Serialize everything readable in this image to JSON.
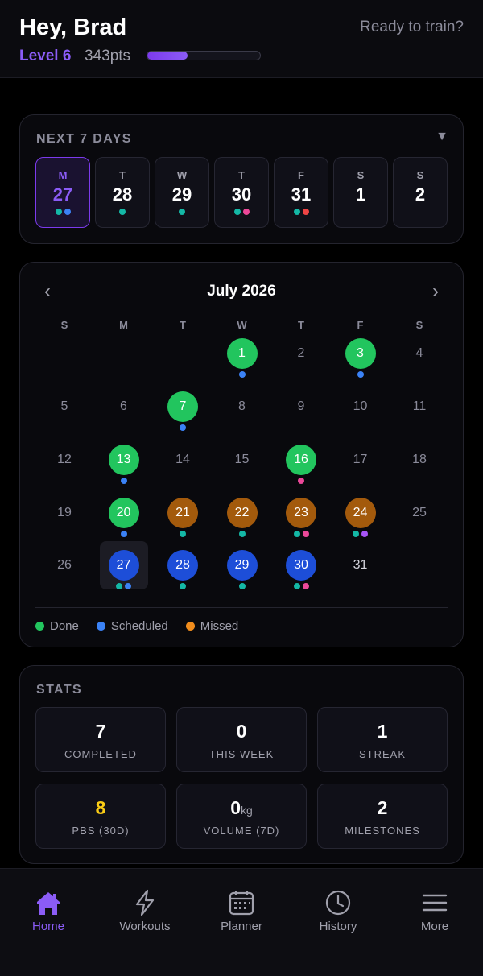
{
  "header": {
    "greeting": "Hey, Brad",
    "ready_text": "Ready to train?",
    "level": "Level 6",
    "points": "343pts",
    "progress_fraction": 0.36,
    "accent_color": "#8b5cf6"
  },
  "week": {
    "title": "NEXT 7 DAYS",
    "toggle_icon": "caret-down-icon",
    "toggle_glyph": "▼",
    "days": [
      {
        "letter": "M",
        "number": "27",
        "active": true,
        "dots": [
          "#14b8a6",
          "#3b82f6"
        ]
      },
      {
        "letter": "T",
        "number": "28",
        "active": false,
        "dots": [
          "#14b8a6"
        ]
      },
      {
        "letter": "W",
        "number": "29",
        "active": false,
        "dots": [
          "#14b8a6"
        ]
      },
      {
        "letter": "T",
        "number": "30",
        "active": false,
        "dots": [
          "#14b8a6",
          "#ec4899"
        ]
      },
      {
        "letter": "F",
        "number": "31",
        "active": false,
        "dots": [
          "#14b8a6",
          "#ef4444"
        ]
      },
      {
        "letter": "S",
        "number": "1",
        "active": false,
        "dots": []
      },
      {
        "letter": "S",
        "number": "2",
        "active": false,
        "dots": []
      }
    ]
  },
  "calendar": {
    "month": "July 2026",
    "prev_glyph": "‹",
    "next_glyph": "›",
    "weekdays": [
      "S",
      "M",
      "T",
      "W",
      "T",
      "F",
      "S"
    ],
    "days": [
      {
        "n": "1",
        "status": "done",
        "dots": [
          "#3b82f6"
        ]
      },
      {
        "n": "2",
        "status": "none",
        "dots": []
      },
      {
        "n": "3",
        "status": "done",
        "dots": [
          "#3b82f6"
        ]
      },
      {
        "n": "4",
        "status": "none",
        "dots": []
      },
      {
        "n": "5",
        "status": "none",
        "dots": []
      },
      {
        "n": "6",
        "status": "none",
        "dots": []
      },
      {
        "n": "7",
        "status": "done",
        "dots": [
          "#3b82f6"
        ]
      },
      {
        "n": "8",
        "status": "none",
        "dots": []
      },
      {
        "n": "9",
        "status": "none",
        "dots": []
      },
      {
        "n": "10",
        "status": "none",
        "dots": []
      },
      {
        "n": "11",
        "status": "none",
        "dots": []
      },
      {
        "n": "12",
        "status": "none",
        "dots": []
      },
      {
        "n": "13",
        "status": "done",
        "dots": [
          "#3b82f6"
        ]
      },
      {
        "n": "14",
        "status": "none",
        "dots": []
      },
      {
        "n": "15",
        "status": "none",
        "dots": []
      },
      {
        "n": "16",
        "status": "done",
        "dots": [
          "#ec4899"
        ]
      },
      {
        "n": "17",
        "status": "none",
        "dots": []
      },
      {
        "n": "18",
        "status": "none",
        "dots": []
      },
      {
        "n": "19",
        "status": "none",
        "dots": []
      },
      {
        "n": "20",
        "status": "done",
        "dots": [
          "#3b82f6"
        ]
      },
      {
        "n": "21",
        "status": "missed",
        "dots": [
          "#14b8a6"
        ]
      },
      {
        "n": "22",
        "status": "missed",
        "dots": [
          "#14b8a6"
        ]
      },
      {
        "n": "23",
        "status": "missed",
        "dots": [
          "#14b8a6",
          "#ec4899"
        ]
      },
      {
        "n": "24",
        "status": "missed",
        "dots": [
          "#14b8a6",
          "#a855f7"
        ]
      },
      {
        "n": "25",
        "status": "none",
        "dots": []
      },
      {
        "n": "26",
        "status": "none",
        "dots": []
      },
      {
        "n": "27",
        "status": "sched",
        "today": true,
        "dots": [
          "#14b8a6",
          "#3b82f6"
        ]
      },
      {
        "n": "28",
        "status": "sched",
        "dots": [
          "#14b8a6"
        ]
      },
      {
        "n": "29",
        "status": "sched",
        "dots": [
          "#14b8a6"
        ]
      },
      {
        "n": "30",
        "status": "sched",
        "dots": [
          "#14b8a6",
          "#ec4899"
        ]
      },
      {
        "n": "31",
        "status": "light",
        "dots": []
      }
    ],
    "legend": [
      {
        "label": "Done",
        "color": "#22c55e"
      },
      {
        "label": "Scheduled",
        "color": "#3b82f6"
      },
      {
        "label": "Missed",
        "color": "#f08c1c"
      }
    ]
  },
  "stats": {
    "title": "STATS",
    "items": [
      {
        "value": "7",
        "unit": "",
        "label": "COMPLETED",
        "gold": false
      },
      {
        "value": "0",
        "unit": "",
        "label": "THIS WEEK",
        "gold": false
      },
      {
        "value": "1",
        "unit": "",
        "label": "STREAK",
        "gold": false
      },
      {
        "value": "8",
        "unit": "",
        "label": "PBS (30D)",
        "gold": true
      },
      {
        "value": "0",
        "unit": "kg",
        "label": "VOLUME (7D)",
        "gold": false
      },
      {
        "value": "2",
        "unit": "",
        "label": "MILESTONES",
        "gold": false
      }
    ]
  },
  "nav": {
    "items": [
      {
        "label": "Home",
        "icon": "home-icon",
        "active": true
      },
      {
        "label": "Workouts",
        "icon": "lightning-icon",
        "active": false
      },
      {
        "label": "Planner",
        "icon": "calendar-icon",
        "active": false
      },
      {
        "label": "History",
        "icon": "clock-icon",
        "active": false
      },
      {
        "label": "More",
        "icon": "menu-icon",
        "active": false
      }
    ]
  }
}
